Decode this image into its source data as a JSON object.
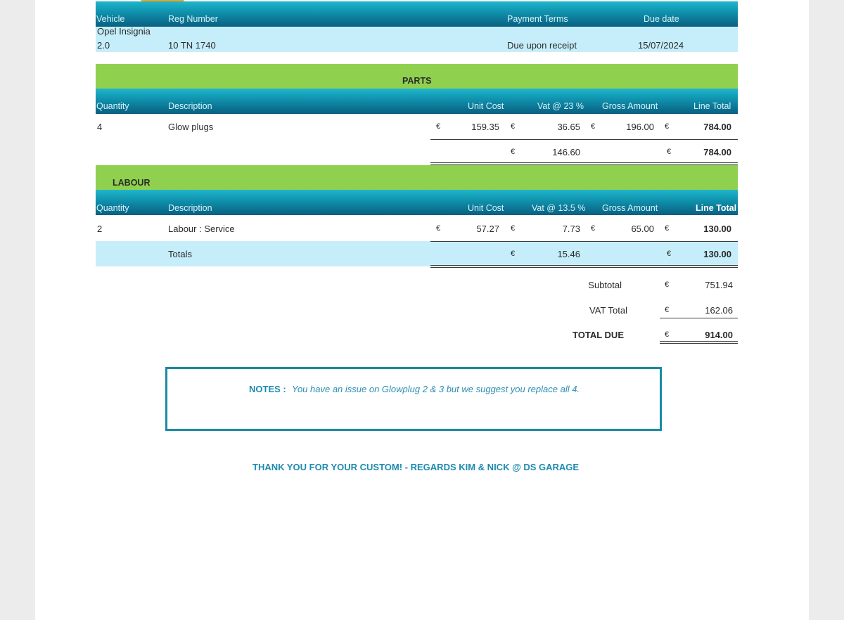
{
  "info_header": {
    "vehicle": "Vehicle",
    "reg_number": "Reg Number",
    "payment_terms": "Payment Terms",
    "due_date": "Due date"
  },
  "info_row": {
    "vehicle_line1": "Opel Insignia",
    "vehicle_line2": "2.0",
    "reg_number": "10 TN 1740",
    "payment_terms": "Due upon receipt",
    "due_date": "15/07/2024"
  },
  "parts": {
    "title": "PARTS",
    "headers": {
      "quantity": "Quantity",
      "description": "Description",
      "unit_cost": "Unit Cost",
      "vat": "Vat @ 23 %",
      "gross": "Gross Amount",
      "line_total": "Line Total"
    },
    "rows": [
      {
        "quantity": "4",
        "description": "Glow plugs",
        "unit_cost": "159.35",
        "vat": "36.65",
        "gross": "196.00",
        "line_total": "784.00"
      }
    ],
    "totals": {
      "vat": "146.60",
      "line_total": "784.00"
    }
  },
  "labour": {
    "title": "LABOUR",
    "headers": {
      "quantity": "Quantity",
      "description": "Description",
      "unit_cost": "Unit Cost",
      "vat": "Vat @ 13.5 %",
      "gross": "Gross Amount",
      "line_total": "Line Total"
    },
    "rows": [
      {
        "quantity": "2",
        "description": "Labour : Service",
        "unit_cost": "57.27",
        "vat": "7.73",
        "gross": "65.00",
        "line_total": "130.00"
      }
    ],
    "totals": {
      "label": "Totals",
      "vat": "15.46",
      "line_total": "130.00"
    }
  },
  "currency": "€",
  "summary": {
    "subtotal_label": "Subtotal",
    "subtotal": "751.94",
    "vat_total_label": "VAT Total",
    "vat_total": "162.06",
    "total_due_label": "TOTAL DUE",
    "total_due": "914.00"
  },
  "notes": {
    "label": "NOTES :",
    "text": "You have an issue on Glowplug 2 & 3 but we suggest you replace all 4."
  },
  "footer": {
    "thanks": "THANK YOU FOR YOUR CUSTOM!  - REGARDS KIM & NICK @ DS GARAGE"
  },
  "colors": {
    "header_teal": "#0f8fab",
    "section_green": "#8fd14f",
    "light_blue_row": "#c6eefa",
    "notes_border": "#1b8aa3"
  }
}
